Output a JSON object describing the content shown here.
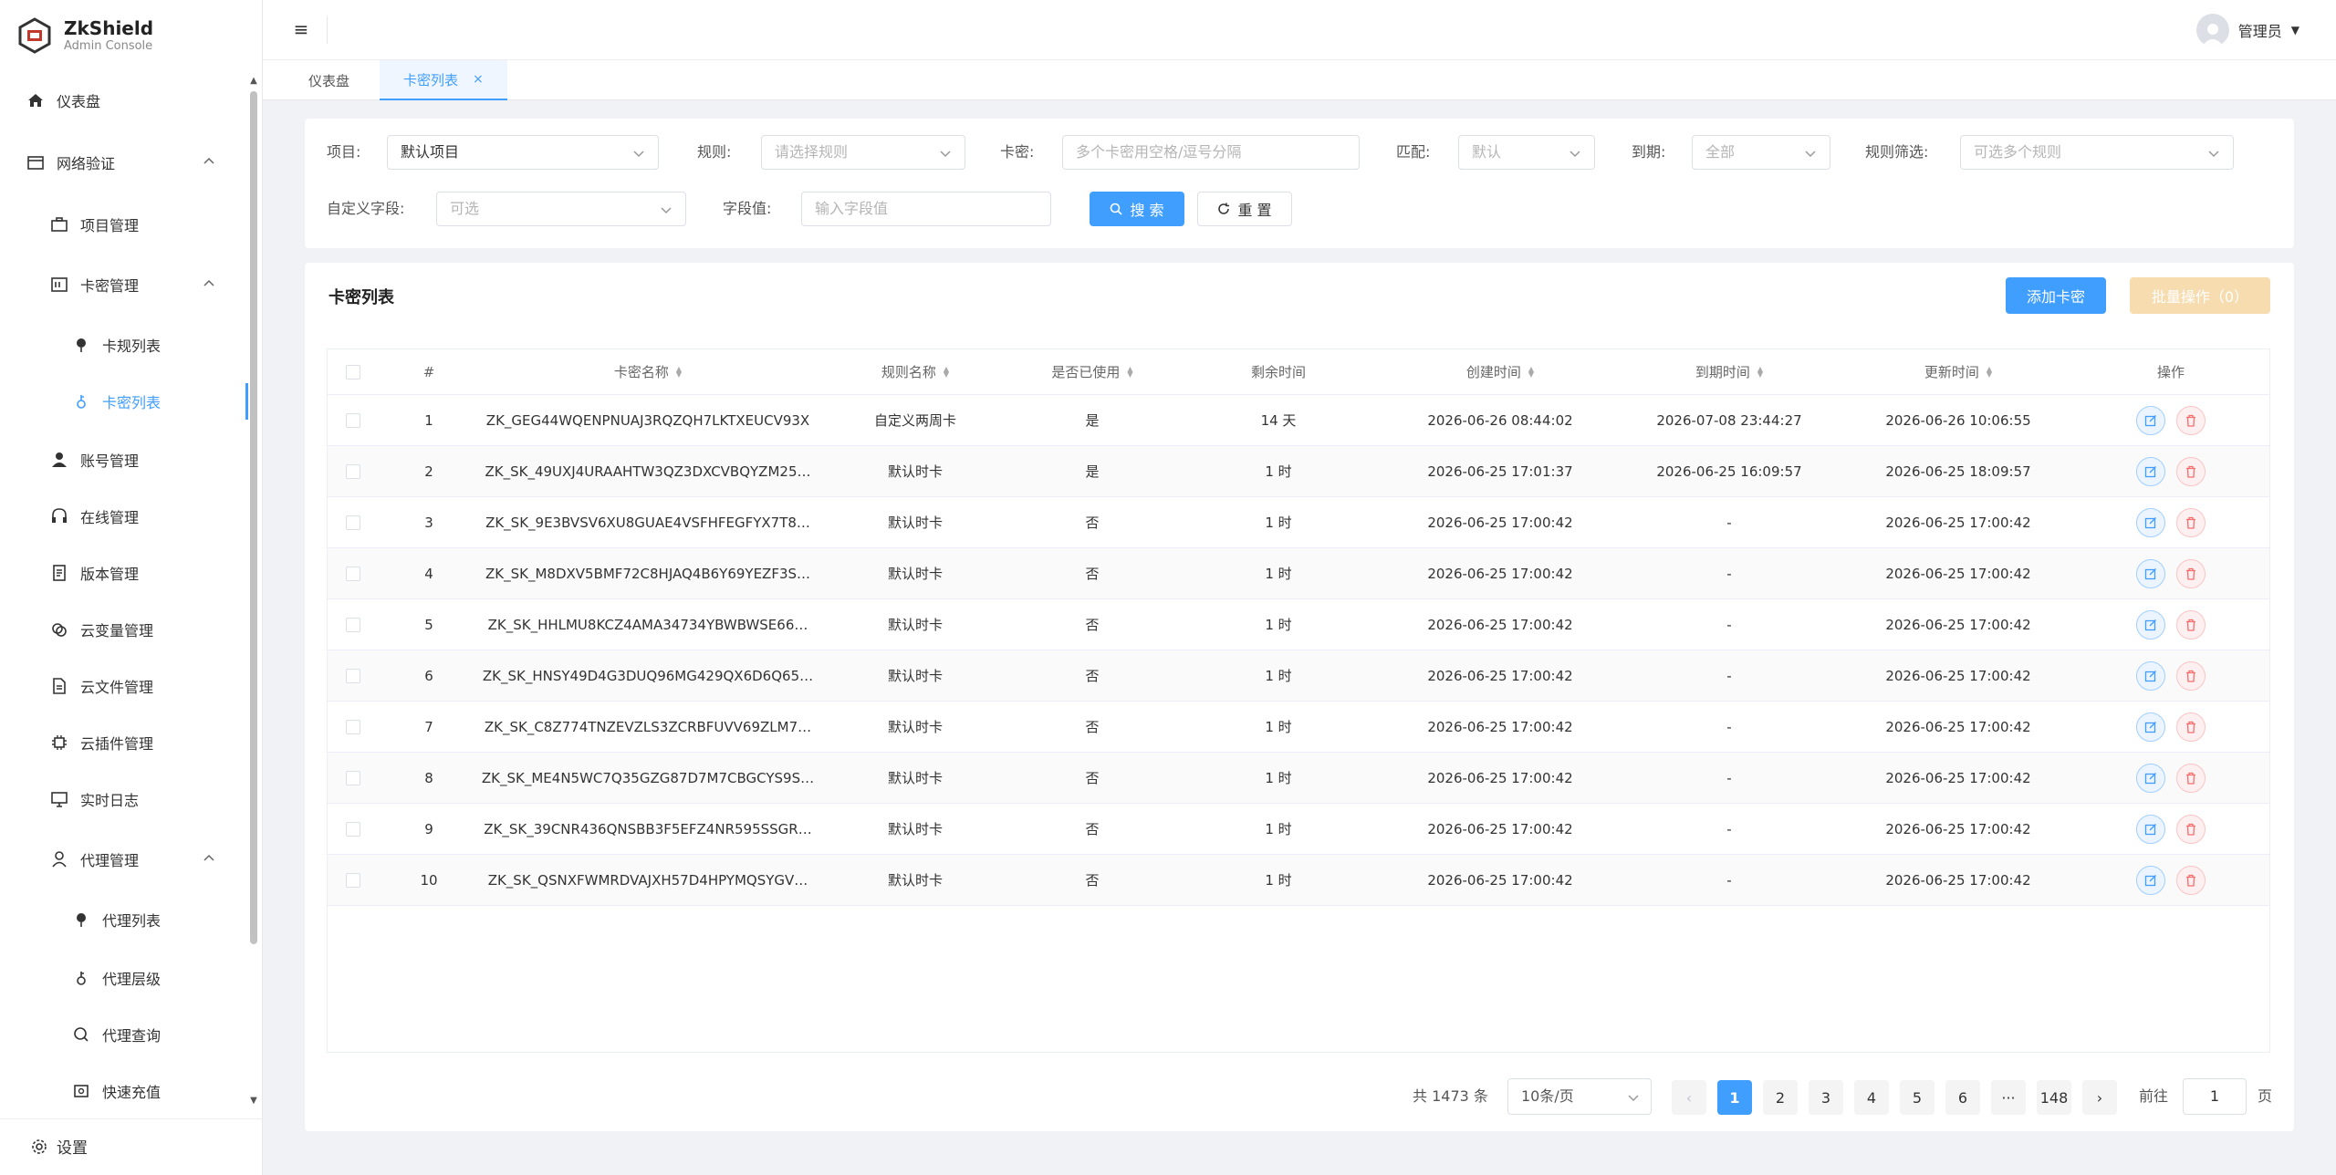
{
  "brand": {
    "title": "ZkShield",
    "subtitle": "Admin Console"
  },
  "sidebar": {
    "items": [
      {
        "label": "仪表盘",
        "icon": "home-icon"
      },
      {
        "label": "网络验证",
        "icon": "box-icon"
      },
      {
        "label": "项目管理",
        "icon": "briefcase-icon"
      },
      {
        "label": "卡密管理",
        "icon": "card-icon"
      },
      {
        "label": "卡规列表",
        "icon": "pin-icon"
      },
      {
        "label": "卡密列表",
        "icon": "key-icon"
      },
      {
        "label": "账号管理",
        "icon": "user-icon"
      },
      {
        "label": "在线管理",
        "icon": "headset-icon"
      },
      {
        "label": "版本管理",
        "icon": "doc-icon"
      },
      {
        "label": "云变量管理",
        "icon": "coins-icon"
      },
      {
        "label": "云文件管理",
        "icon": "file-icon"
      },
      {
        "label": "云插件管理",
        "icon": "chip-icon"
      },
      {
        "label": "实时日志",
        "icon": "monitor-icon"
      },
      {
        "label": "代理管理",
        "icon": "user-outline-icon"
      },
      {
        "label": "代理列表",
        "icon": "pin-icon"
      },
      {
        "label": "代理层级",
        "icon": "key-icon"
      },
      {
        "label": "代理查询",
        "icon": "search-icon"
      },
      {
        "label": "快速充值",
        "icon": "wallet-icon"
      }
    ],
    "footer_label": "设置"
  },
  "header": {
    "user_name": "管理员"
  },
  "tabs": [
    {
      "label": "仪表盘"
    },
    {
      "label": "卡密列表",
      "close": "×"
    }
  ],
  "filters": {
    "project_label": "项目:",
    "project_value": "默认项目",
    "rule_label": "规则:",
    "rule_placeholder": "请选择规则",
    "card_label": "卡密:",
    "card_placeholder": "多个卡密用空格/逗号分隔",
    "match_label": "匹配:",
    "match_value": "默认",
    "expire_label": "到期:",
    "expire_value": "全部",
    "rule_filter_label": "规则筛选:",
    "rule_filter_placeholder": "可选多个规则",
    "custom_field_label": "自定义字段:",
    "custom_field_placeholder": "可选",
    "field_value_label": "字段值:",
    "field_value_placeholder": "输入字段值",
    "search_label": "搜 索",
    "reset_label": "重 置"
  },
  "table_card": {
    "title": "卡密列表",
    "add_label": "添加卡密",
    "batch_label": "批量操作（0）"
  },
  "table": {
    "columns": [
      "#",
      "卡密名称",
      "规则名称",
      "是否已使用",
      "剩余时间",
      "创建时间",
      "到期时间",
      "更新时间",
      "操作"
    ],
    "rows": [
      [
        "1",
        "ZK_GEG44WQENPNUAJ3RQZQH7LKTXEUCV93X",
        "自定义两周卡",
        "是",
        "14 天",
        "2026-06-26 08:44:02",
        "2026-07-08 23:44:27",
        "2026-06-26 10:06:55"
      ],
      [
        "2",
        "ZK_SK_49UXJ4URAAHTW3QZ3DXCVBQYZM25…",
        "默认时卡",
        "是",
        "1 时",
        "2026-06-25 17:01:37",
        "2026-06-25 16:09:57",
        "2026-06-25 18:09:57"
      ],
      [
        "3",
        "ZK_SK_9E3BVSV6XU8GUAE4VSFHFEGFYX7T8…",
        "默认时卡",
        "否",
        "1 时",
        "2026-06-25 17:00:42",
        "-",
        "2026-06-25 17:00:42"
      ],
      [
        "4",
        "ZK_SK_M8DXV5BMF72C8HJAQ4B6Y69YEZF3S…",
        "默认时卡",
        "否",
        "1 时",
        "2026-06-25 17:00:42",
        "-",
        "2026-06-25 17:00:42"
      ],
      [
        "5",
        "ZK_SK_HHLMU8KCZ4AMA34734YBWBWSE66…",
        "默认时卡",
        "否",
        "1 时",
        "2026-06-25 17:00:42",
        "-",
        "2026-06-25 17:00:42"
      ],
      [
        "6",
        "ZK_SK_HNSY49D4G3DUQ96MG429QX6D6Q65…",
        "默认时卡",
        "否",
        "1 时",
        "2026-06-25 17:00:42",
        "-",
        "2026-06-25 17:00:42"
      ],
      [
        "7",
        "ZK_SK_C8Z774TNZEVZLS3ZCRBFUVV69ZLM7…",
        "默认时卡",
        "否",
        "1 时",
        "2026-06-25 17:00:42",
        "-",
        "2026-06-25 17:00:42"
      ],
      [
        "8",
        "ZK_SK_ME4N5WC7Q35GZG87D7M7CBGCYS9S…",
        "默认时卡",
        "否",
        "1 时",
        "2026-06-25 17:00:42",
        "-",
        "2026-06-25 17:00:42"
      ],
      [
        "9",
        "ZK_SK_39CNR436QNSBB3F5EFZ4NR595SSGR…",
        "默认时卡",
        "否",
        "1 时",
        "2026-06-25 17:00:42",
        "-",
        "2026-06-25 17:00:42"
      ],
      [
        "10",
        "ZK_SK_QSNXFWMRDVAJXH57D4HPYMQSYGV…",
        "默认时卡",
        "否",
        "1 时",
        "2026-06-25 17:00:42",
        "-",
        "2026-06-25 17:00:42"
      ]
    ]
  },
  "pagination": {
    "total": "共 1473 条",
    "page_size": "10条/页",
    "prev": "‹",
    "pages": [
      "1",
      "2",
      "3",
      "4",
      "5",
      "6",
      "···",
      "148"
    ],
    "next": "›",
    "goto_label": "前往",
    "goto_value": "1",
    "page_suffix": "页"
  },
  "colors": {
    "primary": "#409eff",
    "danger": "#f56c6c",
    "warning_disabled": "#f7dcb0"
  }
}
